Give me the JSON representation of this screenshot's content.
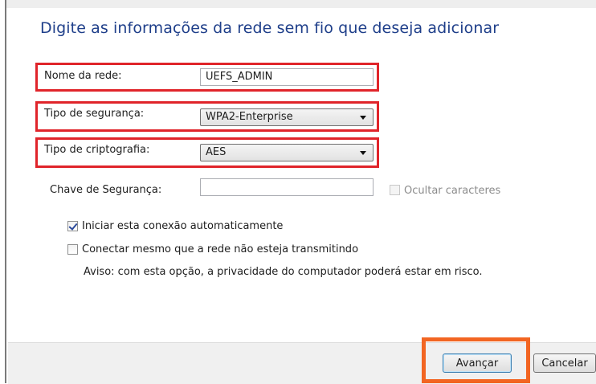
{
  "dialog": {
    "heading": "Digite as informações da rede sem fio que deseja adicionar"
  },
  "form": {
    "network_name": {
      "label": "Nome da rede:",
      "value": "UEFS_ADMIN"
    },
    "security_type": {
      "label": "Tipo de segurança:",
      "value": "WPA2-Enterprise"
    },
    "encryption_type": {
      "label": "Tipo de criptografia:",
      "value": "AES"
    },
    "security_key": {
      "label": "Chave de Segurança:",
      "value": ""
    },
    "hide_characters": {
      "label": "Ocultar caracteres",
      "checked": false,
      "enabled": false
    },
    "auto_connect": {
      "label": "Iniciar esta conexão automaticamente",
      "checked": true
    },
    "connect_hidden": {
      "label": "Conectar mesmo que a rede não esteja transmitindo",
      "checked": false
    },
    "warning": "Aviso: com esta opção, a privacidade do computador poderá estar em risco."
  },
  "buttons": {
    "next": "Avançar",
    "cancel": "Cancelar"
  },
  "colors": {
    "heading": "#1f3f8a",
    "highlight_red": "#e0242a",
    "highlight_orange": "#f26522"
  }
}
